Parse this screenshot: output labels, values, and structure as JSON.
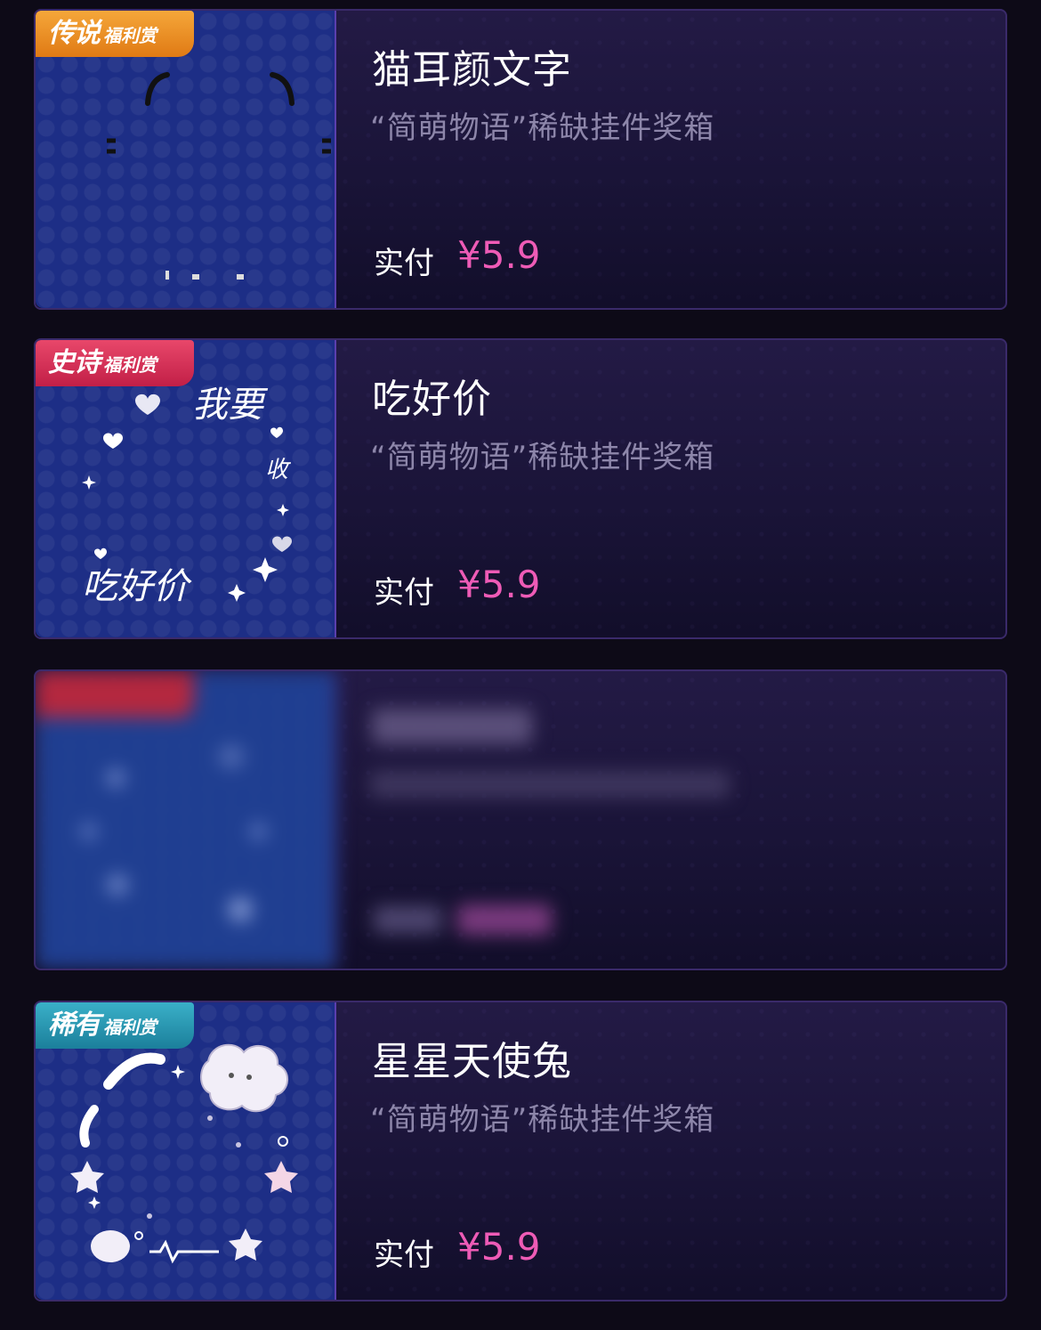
{
  "items": [
    {
      "badge_main": "传说",
      "badge_sub": "福利赏",
      "title": "猫耳颜文字",
      "subtitle": "“简萌物语”稀缺挂件奖箱",
      "pay_label": "实付",
      "price": "¥5.9"
    },
    {
      "badge_main": "史诗",
      "badge_sub": "福利赏",
      "title": "吃好价",
      "subtitle": "“简萌物语”稀缺挂件奖箱",
      "pay_label": "实付",
      "price": "¥5.9",
      "art_text": {
        "top": "我要",
        "side": "收",
        "bottom": "吃好价"
      }
    },
    {
      "blurred": true
    },
    {
      "badge_main": "稀有",
      "badge_sub": "福利赏",
      "title": "星星天使兔",
      "subtitle": "“简萌物语”稀缺挂件奖箱",
      "pay_label": "实付",
      "price": "¥5.9"
    }
  ]
}
